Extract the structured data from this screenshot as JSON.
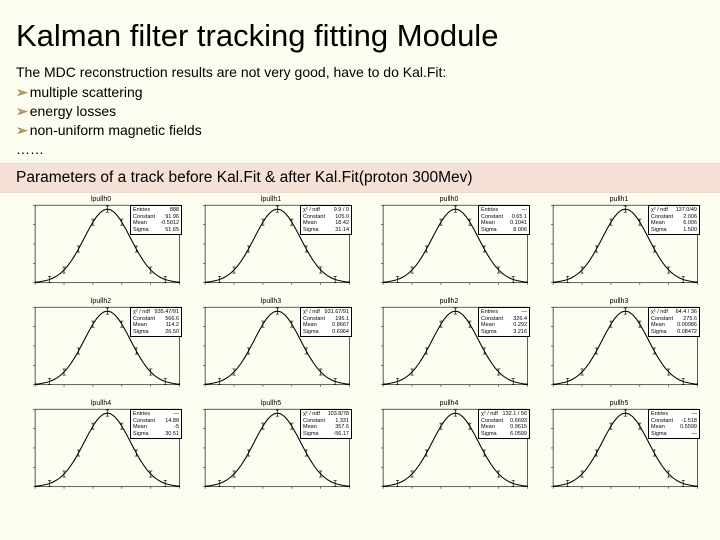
{
  "title": "Kalman filter tracking fitting Module",
  "intro": "The MDC reconstruction results are not very good, have to do Kal.Fit:",
  "bullets": [
    "multiple scattering",
    "energy losses",
    "non-uniform magnetic fields"
  ],
  "dots": "……",
  "band": "Parameters of a track before Kal.Fit  & after Kal.Fit(proton 300Mev)",
  "panels_left": [
    {
      "title": "lpullh0",
      "stats": [
        [
          "Entries",
          "888"
        ],
        [
          "Constant",
          "91.96"
        ],
        [
          "Mean",
          "-0.5012"
        ],
        [
          "Sigma",
          "51.65"
        ]
      ]
    },
    {
      "title": "lpullh1",
      "stats": [
        [
          "χ² / ndf",
          "9.9 / 0"
        ],
        [
          "Constant",
          "105.0"
        ],
        [
          "Mean",
          "18.42"
        ],
        [
          "Sigma",
          "31.14"
        ]
      ]
    },
    {
      "title": "lpullh2",
      "stats": [
        [
          "χ² / ndf",
          "935.47/91"
        ],
        [
          "Constant",
          "566.6"
        ],
        [
          "Mean",
          "114.2"
        ],
        [
          "Sigma",
          "26.50"
        ]
      ]
    },
    {
      "title": "lpullh3",
      "stats": [
        [
          "χ² / ndf",
          "931.67/91"
        ],
        [
          "Constant",
          "196.1"
        ],
        [
          "Mean",
          "0.8667"
        ],
        [
          "Sigma",
          "0.6964"
        ]
      ]
    },
    {
      "title": "lpullh4",
      "stats": [
        [
          "Entries",
          "—"
        ],
        [
          "Constant",
          "14.88"
        ],
        [
          "Mean",
          "-5"
        ],
        [
          "Sigma",
          "30.51"
        ]
      ]
    },
    {
      "title": "lpullh5",
      "stats": [
        [
          "χ² / ndf",
          "103.8/78"
        ],
        [
          "Constant",
          "1.331"
        ],
        [
          "Mean",
          "357.6"
        ],
        [
          "Sigma",
          "-56.17"
        ]
      ]
    }
  ],
  "panels_right": [
    {
      "title": "pullh0",
      "stats": [
        [
          "Entries",
          "—"
        ],
        [
          "Constant",
          "0.65 1"
        ],
        [
          "Mean",
          "0.1041"
        ],
        [
          "Sigma",
          "8.006"
        ]
      ]
    },
    {
      "title": "pullh1",
      "stats": [
        [
          "χ² / ndf",
          "137.0/49"
        ],
        [
          "Constant",
          "2.006"
        ],
        [
          "Mean",
          "6.006"
        ],
        [
          "Sigma",
          "1.500"
        ]
      ]
    },
    {
      "title": "pullh2",
      "stats": [
        [
          "Entries",
          "—"
        ],
        [
          "Constant",
          "326.4"
        ],
        [
          "Mean",
          "0.292"
        ],
        [
          "Sigma",
          "3.216"
        ]
      ]
    },
    {
      "title": "pullh3",
      "stats": [
        [
          "χ² / ndf",
          "64.4 / 36"
        ],
        [
          "Constant",
          "275.6"
        ],
        [
          "Mean",
          "0.00986"
        ],
        [
          "Sigma",
          "0.08472"
        ]
      ]
    },
    {
      "title": "pullh4",
      "stats": [
        [
          "χ² / ndf",
          "132.1 / 56"
        ],
        [
          "Constant",
          "0.6693"
        ],
        [
          "Mean",
          "0.9615"
        ],
        [
          "Sigma",
          "6.0599"
        ]
      ]
    },
    {
      "title": "pullh5",
      "stats": [
        [
          "Entries",
          "—"
        ],
        [
          "Constant",
          "-1.518"
        ],
        [
          "Mean",
          "0.5599"
        ],
        [
          "Sigma",
          "—"
        ]
      ]
    }
  ],
  "chart_data": {
    "type": "line",
    "note": "Each of 12 small-multiple panels shows a 1D histogram with Gaussian fit; numeric fit parameters are given in each panel's stats box (Constant/Mean/Sigma). Histogram bin contents are not legible at source resolution.",
    "panels": 12
  }
}
